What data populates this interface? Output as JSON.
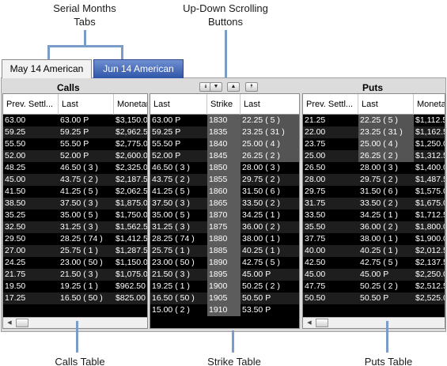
{
  "annotations": {
    "serial_tabs_line1": "Serial Months",
    "serial_tabs_line2": "Tabs",
    "scroll_buttons_line1": "Up-Down Scrolling",
    "scroll_buttons_line2": "Buttons",
    "calls_table": "Calls Table",
    "strike_table": "Strike Table",
    "puts_table": "Puts Table"
  },
  "tabs": [
    {
      "label": "May 14 American",
      "active": false
    },
    {
      "label": "Jun 14 American",
      "active": true
    }
  ],
  "scroll_buttons": {
    "page_down": "⯯",
    "row_down": "▼",
    "row_up": "▲",
    "page_up": "⯭"
  },
  "calls": {
    "title": "Calls",
    "headers": [
      "Prev. Settl...",
      "Last",
      "Monetar"
    ],
    "rows": [
      [
        "63.00",
        "63.00 P",
        "$3,150.0"
      ],
      [
        "59.25",
        "59.25 P",
        "$2,962.5"
      ],
      [
        "55.50",
        "55.50 P",
        "$2,775.0"
      ],
      [
        "52.00",
        "52.00 P",
        "$2,600.0"
      ],
      [
        "48.25",
        "46.50 ( 3 )",
        "$2,325.0"
      ],
      [
        "45.00",
        "43.75 ( 2 )",
        "$2,187.5"
      ],
      [
        "41.50",
        "41.25 ( 5 )",
        "$2,062.5"
      ],
      [
        "38.50",
        "37.50 ( 3 )",
        "$1,875.0"
      ],
      [
        "35.25",
        "35.00 ( 5 )",
        "$1,750.0"
      ],
      [
        "32.50",
        "31.25 ( 3 )",
        "$1,562.5"
      ],
      [
        "29.50",
        "28.25 ( 74 )",
        "$1,412.5"
      ],
      [
        "27.00",
        "25.75 ( 1 )",
        "$1,287.5"
      ],
      [
        "24.25",
        "23.00 ( 50 )",
        "$1,150.0"
      ],
      [
        "21.75",
        "21.50 ( 3 )",
        "$1,075.0"
      ],
      [
        "19.50",
        "19.25 ( 1 )",
        "$962.50"
      ],
      [
        "17.25",
        "16.50 ( 50 )",
        "$825.00"
      ]
    ]
  },
  "strike": {
    "headers": [
      "Last",
      "Strike",
      "Last"
    ],
    "rows": [
      [
        "63.00 P",
        "1830",
        "22.25 ( 5 )"
      ],
      [
        "59.25 P",
        "1835",
        "23.25 ( 31 )"
      ],
      [
        "55.50 P",
        "1840",
        "25.00 ( 4 )"
      ],
      [
        "52.00 P",
        "1845",
        "26.25 ( 2 )"
      ],
      [
        "46.50 ( 3 )",
        "1850",
        "28.00 ( 3 )"
      ],
      [
        "43.75 ( 2 )",
        "1855",
        "29.75 ( 2 )"
      ],
      [
        "41.25 ( 5 )",
        "1860",
        "31.50 ( 6 )"
      ],
      [
        "37.50 ( 3 )",
        "1865",
        "33.50 ( 2 )"
      ],
      [
        "35.00 ( 5 )",
        "1870",
        "34.25 ( 1 )"
      ],
      [
        "31.25 ( 3 )",
        "1875",
        "36.00 ( 2 )"
      ],
      [
        "28.25 ( 74 )",
        "1880",
        "38.00 ( 1 )"
      ],
      [
        "25.75 ( 1 )",
        "1885",
        "40.25 ( 1 )"
      ],
      [
        "23.00 ( 50 )",
        "1890",
        "42.75 ( 5 )"
      ],
      [
        "21.50 ( 3 )",
        "1895",
        "45.00 P"
      ],
      [
        "19.25 ( 1 )",
        "1900",
        "50.25 ( 2 )"
      ],
      [
        "16.50 ( 50 )",
        "1905",
        "50.50 P"
      ],
      [
        "15.00 ( 2 )",
        "1910",
        "53.50 P"
      ]
    ]
  },
  "puts": {
    "title": "Puts",
    "headers": [
      "Prev. Settl...",
      "Last",
      "Moneta"
    ],
    "rows": [
      [
        "21.25",
        "22.25 ( 5 )",
        "$1,112.5"
      ],
      [
        "22.00",
        "23.25 ( 31 )",
        "$1,162.5"
      ],
      [
        "23.75",
        "25.00 ( 4 )",
        "$1,250.0"
      ],
      [
        "25.00",
        "26.25 ( 2 )",
        "$1,312.5"
      ],
      [
        "26.50",
        "28.00 ( 3 )",
        "$1,400.0"
      ],
      [
        "28.00",
        "29.75 ( 2 )",
        "$1,487.5"
      ],
      [
        "29.75",
        "31.50 ( 6 )",
        "$1,575.0"
      ],
      [
        "31.75",
        "33.50 ( 2 )",
        "$1,675.0"
      ],
      [
        "33.50",
        "34.25 ( 1 )",
        "$1,712.5"
      ],
      [
        "35.50",
        "36.00 ( 2 )",
        "$1,800.0"
      ],
      [
        "37.75",
        "38.00 ( 1 )",
        "$1,900.0"
      ],
      [
        "40.00",
        "40.25 ( 1 )",
        "$2,012.5"
      ],
      [
        "42.50",
        "42.75 ( 5 )",
        "$2,137.5"
      ],
      [
        "45.00",
        "45.00 P",
        "$2,250.0"
      ],
      [
        "47.75",
        "50.25 ( 2 )",
        "$2,512.5"
      ],
      [
        "50.50",
        "50.50 P",
        "$2,525.0"
      ]
    ]
  },
  "colors": {
    "row_even": "#000000",
    "row_odd": "#1e1e1e",
    "strike_column": "#5c5c5c",
    "active_tab": "#2f55a8",
    "annotation_line": "#7a9cc8"
  }
}
